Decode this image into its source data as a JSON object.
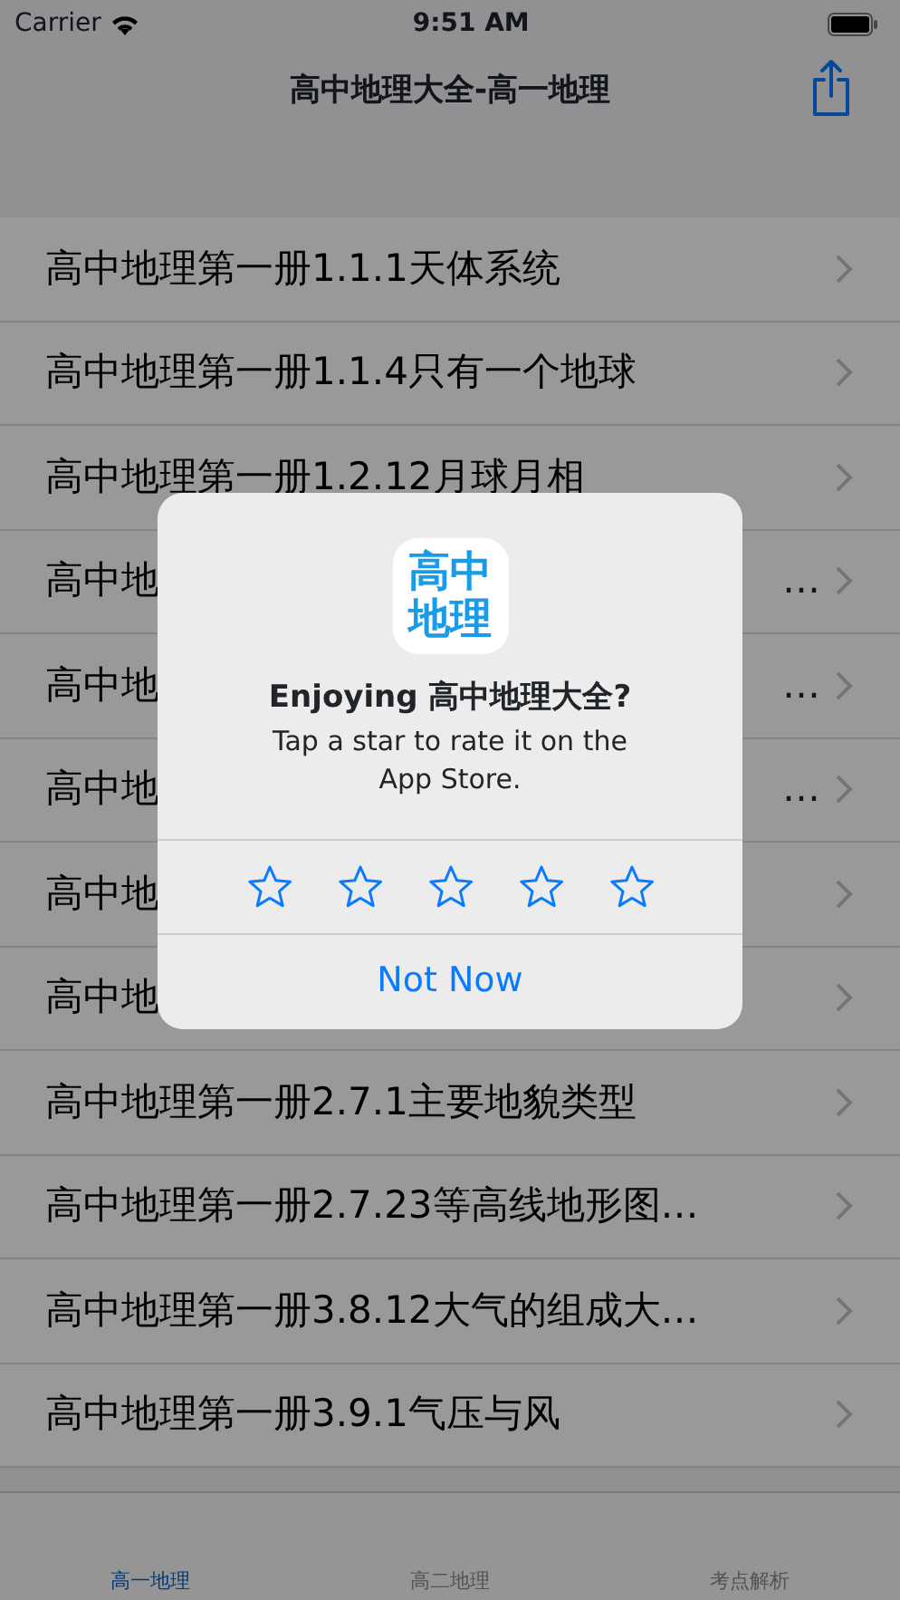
{
  "status_bar": {
    "carrier": "Carrier",
    "time": "9:51 AM"
  },
  "nav": {
    "title": "高中地理大全-高一地理"
  },
  "rows": [
    {
      "text": "高中地理第一册1.1.1天体系统"
    },
    {
      "text": "高中地理第一册1.1.4只有一个地球"
    },
    {
      "text": "高中地理第一册1.2.12月球月相"
    },
    {
      "text": "高中地",
      "tail": "…"
    },
    {
      "text": "高中地",
      "tail": "…"
    },
    {
      "text": "高中地",
      "tail": "…"
    },
    {
      "text": "高中地"
    },
    {
      "text": "高中地"
    },
    {
      "text": "高中地理第一册2.7.1主要地貌类型"
    },
    {
      "text": "高中地理第一册2.7.23等高线地形图…"
    },
    {
      "text": "高中地理第一册3.8.12大气的组成大…"
    },
    {
      "text": "高中地理第一册3.9.1气压与风"
    }
  ],
  "tabs": [
    {
      "label": "高一地理",
      "selected": true
    },
    {
      "label": "高二地理",
      "selected": false
    },
    {
      "label": "考点解析",
      "selected": false
    }
  ],
  "alert": {
    "icon_text": [
      "高中",
      "地理"
    ],
    "title": "Enjoying 高中地理大全?",
    "message": "Tap a star to rate it on the App Store.",
    "stars": 0,
    "button": "Not Now"
  }
}
